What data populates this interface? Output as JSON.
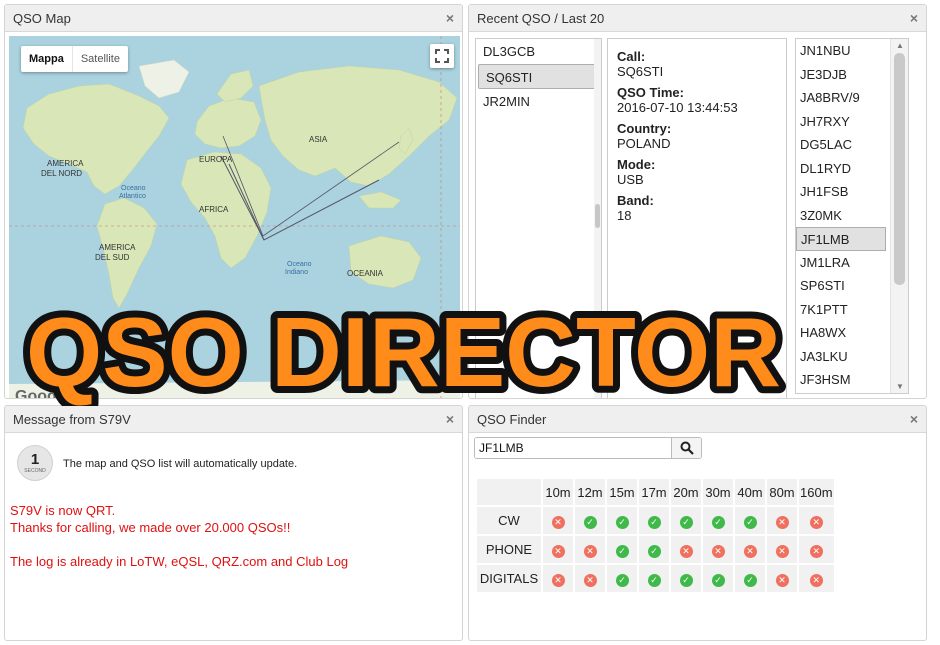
{
  "map": {
    "title": "QSO Map",
    "close": "×",
    "type_map": "Mappa",
    "type_satellite": "Satellite",
    "labels": [
      "AMERICA DEL NORD",
      "EUROPA",
      "ASIA",
      "AFRICA",
      "Oceano Atlantico",
      "AMERICA DEL SUD",
      "Oceano Indiano",
      "OCEANIA"
    ],
    "google": "Google"
  },
  "recent": {
    "title": "Recent QSO / Last 20",
    "close": "×",
    "items": [
      "DL3GCB",
      "SQ6STI",
      "JR2MIN"
    ],
    "selected_index": 1,
    "details": {
      "call_label": "Call:",
      "call": "SQ6STI",
      "time_label": "QSO Time:",
      "time": "2016-07-10 13:44:53",
      "country_label": "Country:",
      "country": "POLAND",
      "mode_label": "Mode:",
      "mode": "USB",
      "band_label": "Band:",
      "band": "18"
    },
    "calls": [
      "JN1NBU",
      "JE3DJB",
      "JA8BRV/9",
      "JH7RXY",
      "DG5LAC",
      "DL1RYD",
      "JH1FSB",
      "3Z0MK",
      "JF1LMB",
      "JM1LRA",
      "SP6STI",
      "7K1PTT",
      "HA8WX",
      "JA3LKU",
      "JF3HSM"
    ],
    "calls_selected_index": 8
  },
  "message": {
    "title": "Message from S79V",
    "close": "×",
    "icon_number": "1",
    "icon_sub": "SECOND",
    "info": "The map and QSO list will automatically update.",
    "line1": "S79V is now QRT.",
    "line2": "Thanks for calling, we made over 20.000 QSOs!!",
    "line3": "The log is already in LoTW, eQSL, QRZ.com and Club Log"
  },
  "finder": {
    "title": "QSO Finder",
    "close": "×",
    "search_value": "JF1LMB",
    "bands": [
      "10m",
      "12m",
      "15m",
      "17m",
      "20m",
      "30m",
      "40m",
      "80m",
      "160m"
    ],
    "rows": [
      {
        "mode": "CW",
        "status": [
          0,
          1,
          1,
          1,
          1,
          1,
          1,
          0,
          0
        ]
      },
      {
        "mode": "PHONE",
        "status": [
          0,
          0,
          1,
          1,
          0,
          0,
          0,
          0,
          0
        ]
      },
      {
        "mode": "DIGITALS",
        "status": [
          0,
          0,
          1,
          1,
          1,
          1,
          1,
          0,
          0
        ]
      }
    ]
  },
  "overlay": {
    "title": "QSO DIRECTOR",
    "fill": "#ff8c1a",
    "outline": "#111111"
  },
  "colors": {
    "ocean": "#aad3df",
    "land": "#d8e6b8",
    "ok": "#3fba4a",
    "no": "#f07060",
    "message_red": "#e01010"
  }
}
